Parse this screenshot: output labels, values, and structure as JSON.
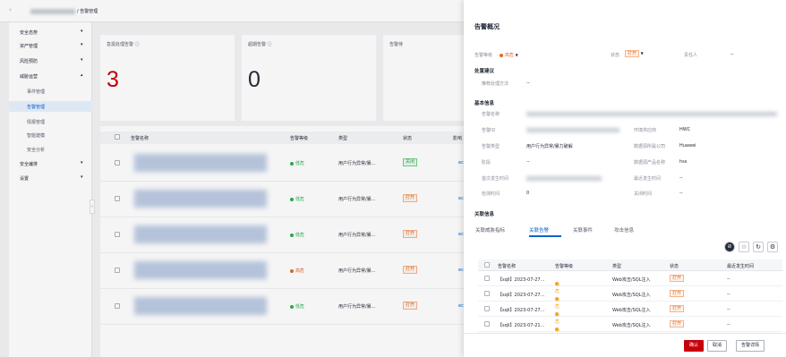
{
  "colors": {
    "accent": "#0a63cf",
    "danger": "#c7000b",
    "low": "#2bb04c",
    "high": "#e46a2a",
    "medium": "#f5a623"
  },
  "breadcrumb": {
    "current": "/ 告警管理"
  },
  "sidebar": {
    "items": [
      {
        "label": "安全态势",
        "has_caret": true
      },
      {
        "label": "资产管理",
        "has_caret": true
      },
      {
        "label": "风险预防",
        "has_caret": true
      },
      {
        "label": "威胁运营",
        "has_caret": true,
        "expanded": true
      },
      {
        "label": "事件管理",
        "sub": true
      },
      {
        "label": "告警管理",
        "sub": true,
        "active": true
      },
      {
        "label": "情报管理",
        "sub": true
      },
      {
        "label": "智能建模",
        "sub": true
      },
      {
        "label": "安全分析",
        "sub": true
      },
      {
        "label": "安全编排",
        "has_caret": true
      },
      {
        "label": "设置",
        "has_caret": true
      }
    ]
  },
  "stats": [
    {
      "title": "急需处理告警 ⓘ",
      "value": "3",
      "color": "#c7000b"
    },
    {
      "title": "超期告警 ⓘ",
      "value": "0",
      "color": "#252b3a"
    },
    {
      "title": "告警待",
      "value": "",
      "color": "#252b3a"
    }
  ],
  "table": {
    "headers": {
      "name": "告警名称",
      "level": "告警等级",
      "type": "类型",
      "status": "状态",
      "resource": "影响"
    },
    "rows": [
      {
        "level": "低危",
        "level_color": "#2bb04c",
        "type": "用户行为异常/暴...",
        "status": "关闭",
        "status_kind": "closed",
        "resource": "ecs-"
      },
      {
        "level": "低危",
        "level_color": "#2bb04c",
        "type": "用户行为异常/暴...",
        "status": "打开",
        "status_kind": "open",
        "resource": "ecs-"
      },
      {
        "level": "低危",
        "level_color": "#2bb04c",
        "type": "用户行为异常/暴...",
        "status": "打开",
        "status_kind": "open",
        "resource": "ecs-"
      },
      {
        "level": "高危",
        "level_color": "#e46a2a",
        "type": "用户行为异常/暴...",
        "status": "打开",
        "status_kind": "open",
        "resource": "ecs-"
      },
      {
        "level": "低危",
        "level_color": "#2bb04c",
        "type": "用户行为异常/暴...",
        "status": "打开",
        "status_kind": "open",
        "resource": "ecs-"
      }
    ]
  },
  "panel": {
    "title": "告警概况",
    "level_label": "告警等级",
    "level_value": "高危",
    "status_label": "状态",
    "status_value": "打开",
    "owner_label": "责任人",
    "owner_value": "--",
    "advice_section": "处置建议",
    "advice_label": "推荐处理方法",
    "advice_value": "--",
    "basic_section": "基本信息",
    "fields": {
      "alarm_name_label": "告警名称",
      "alarm_id_label": "告警ID",
      "env_label": "环境供应商",
      "env_value": "HWC",
      "type_label": "告警类型",
      "type_value": "用户行为异常/暴力破解",
      "data_source_label": "数据源所属公司",
      "data_source_value": "Huawei",
      "stage_label": "阶段",
      "stage_value": "--",
      "product_label": "数据源产品名称",
      "product_value": "hss",
      "first_time_label": "首次发生时间",
      "last_time_label": "最近发生时间",
      "last_time_value": "--",
      "count_label": "检测时间",
      "count_value": "0",
      "close_time_label": "关闭时间",
      "close_time_value": "--"
    },
    "assoc_section": "关联信息",
    "tabs": [
      "关联威胁指标",
      "关联告警",
      "关联事件",
      "攻击信息"
    ],
    "active_tab": 1,
    "sub_headers": {
      "name": "告警名称",
      "level": "告警等级",
      "type": "类型",
      "status": "状态",
      "time": "最近发生时间"
    },
    "sub_rows": [
      {
        "name": "【sqli】2023-07-27...",
        "level": "中危",
        "type": "Web攻击/SQL注入",
        "status": "打开",
        "time": "--"
      },
      {
        "name": "【sqli】2023-07-27...",
        "level": "中危",
        "type": "Web攻击/SQL注入",
        "status": "打开",
        "time": "--"
      },
      {
        "name": "【sqli】2023-07-27...",
        "level": "中危",
        "type": "Web攻击/SQL注入",
        "status": "打开",
        "time": "--"
      },
      {
        "name": "【sqli】2023-07-21...",
        "level": "中危",
        "type": "Web攻击/SQL注入",
        "status": "打开",
        "time": "--"
      }
    ],
    "footer": {
      "confirm": "确认",
      "cancel": "取消",
      "detail": "告警详情"
    }
  }
}
